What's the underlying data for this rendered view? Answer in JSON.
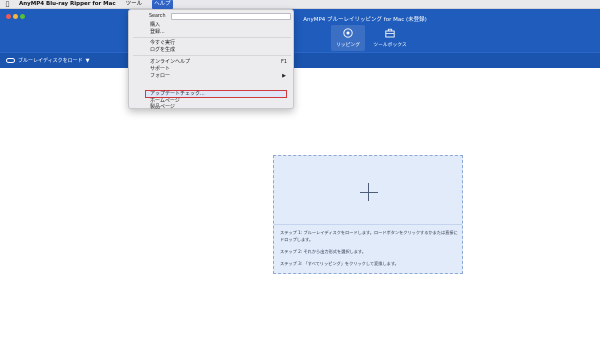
{
  "menubar": {
    "app_name": "AnyMP4 Blu-ray Ripper for Mac",
    "menus": [
      "ツール",
      "ヘルプ"
    ]
  },
  "window": {
    "title": "AnyMP4 ブルーレイリッピング for Mac (未登録)"
  },
  "toolbar": {
    "rip_label": "リッピング",
    "toolbox_label": "ツールボックス"
  },
  "subbar": {
    "load_label": "ブルーレイディスクをロード"
  },
  "dropdown": {
    "search_label": "Search",
    "items": {
      "purchase": "購入",
      "register": "登録...",
      "run_now": "今すぐ実行",
      "create_log": "ログを生成",
      "online_help": "オンラインヘルプ",
      "online_help_shortcut": "F1",
      "support": "サポート",
      "follow": "フォロー",
      "update_check": "アップデートチェック...",
      "homepage": "ホームページ",
      "product_page": "製品ページ"
    }
  },
  "dropzone": {
    "step1": "ステップ 1: ブルーレイディスクをロードします。ロードボタンをクリックするかまたは直接にドロップします。",
    "step2": "ステップ 2: それから出力形式を選択します。",
    "step3": "ステップ 3: 「すべてリッピング」をクリックして変換します。"
  },
  "colors": {
    "brand_blue": "#1f5cbc",
    "highlight_red": "#d13b3b"
  }
}
